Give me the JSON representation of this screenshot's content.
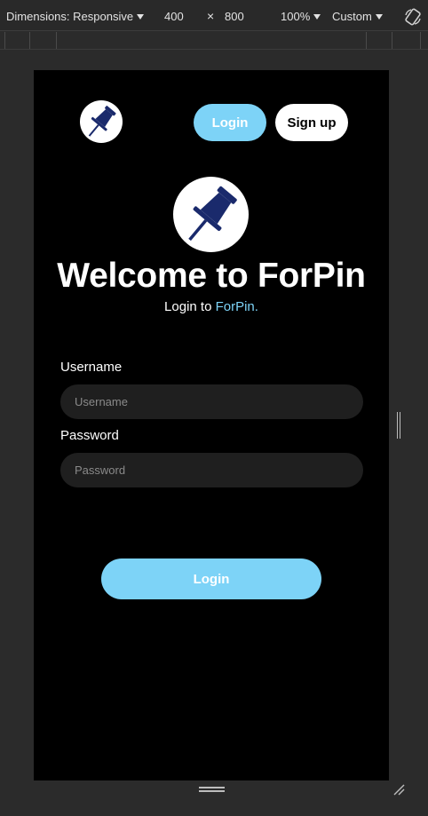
{
  "devtools": {
    "dimensions_label": "Dimensions: Responsive",
    "width": "400",
    "times": "×",
    "height": "800",
    "zoom": "100%",
    "throttle": "Custom",
    "icons": [
      "caret-down-icon",
      "rotate-icon",
      "resize-handle-icon"
    ]
  },
  "app": {
    "nav": {
      "login_label": "Login",
      "signup_label": "Sign up"
    },
    "title": "Welcome to ForPin",
    "subtitle_prefix": "Login to ",
    "subtitle_brand": "ForPin.",
    "form": {
      "username_label": "Username",
      "username_placeholder": "Username",
      "username_value": "",
      "password_label": "Password",
      "password_placeholder": "Password",
      "password_value": ""
    },
    "submit_label": "Login"
  },
  "colors": {
    "accent": "#7dd3f7",
    "background": "#000000",
    "field": "#1f1f1f",
    "pin": "#1a2a6c"
  }
}
